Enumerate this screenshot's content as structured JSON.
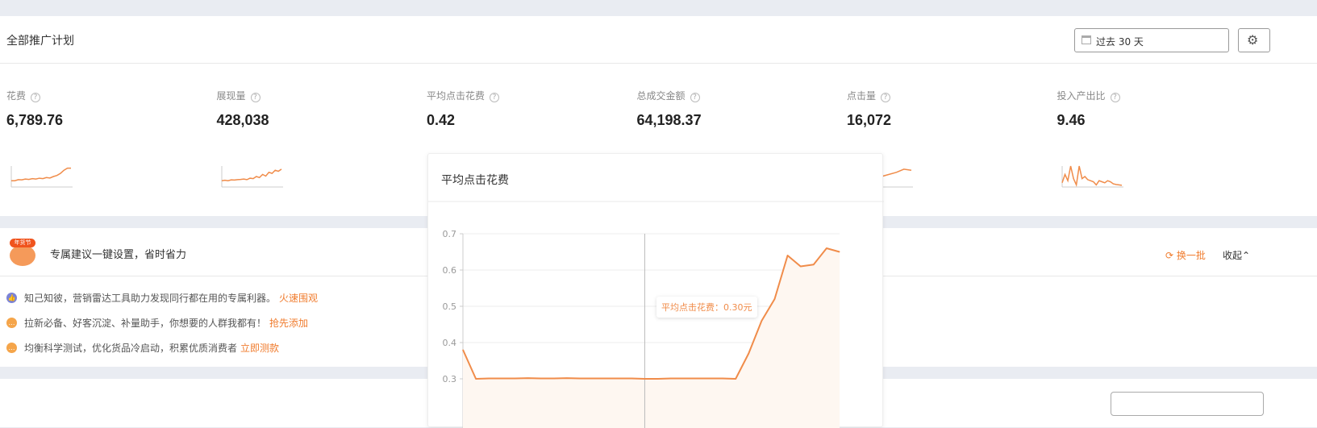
{
  "header": {
    "title": "全部推广计划",
    "date_range": "过去 30 天"
  },
  "metrics": [
    {
      "label": "花费",
      "value": "6,789.76",
      "trend": [
        3,
        3,
        3.5,
        3.4,
        3.8,
        3.6,
        4,
        3.8,
        4.2,
        4,
        4.5,
        4.3,
        5,
        5.5,
        6.5,
        8,
        9,
        9
      ]
    },
    {
      "label": "展现量",
      "value": "428,038",
      "trend": [
        3,
        3.2,
        3,
        3.4,
        3.3,
        3.5,
        3.6,
        3.8,
        3.5,
        4.2,
        4,
        5,
        4.5,
        6,
        5.2,
        7,
        6.5,
        8,
        7.5,
        8.5
      ]
    },
    {
      "label": "平均点击花费",
      "value": "0.42",
      "trend": []
    },
    {
      "label": "总成交金额",
      "value": "64,198.37",
      "trend": []
    },
    {
      "label": "点击量",
      "value": "16,072",
      "trend": [
        3,
        3.5,
        4,
        4.5,
        5,
        6,
        7,
        8.5,
        8
      ]
    },
    {
      "label": "投入产出比",
      "value": "9.46",
      "trend": [
        2,
        6,
        3,
        10,
        4,
        1,
        10,
        4,
        5,
        3.5,
        3,
        2.5,
        1,
        3,
        2.5,
        2,
        3,
        2.5,
        1.5,
        1.2,
        1,
        0.8
      ]
    }
  ],
  "suggestion": {
    "badge": "年货节",
    "title": "专属建议一键设置，省时省力",
    "refresh": "换一批",
    "collapse": "收起",
    "items": [
      {
        "text": "知己知彼，营销雷达工具助力发现同行都在用的专属利器。",
        "link": "火速围观",
        "color": "#7b83d6"
      },
      {
        "text": "拉新必备、好客沉淀、补量助手，你想要的人群我都有！",
        "link": "抢先添加",
        "color": "#f5a54a"
      },
      {
        "text": "均衡科学测试，优化货品冷启动，积累优质消费者",
        "link": "立即测款",
        "color": "#f5a54a"
      }
    ]
  },
  "popup": {
    "title": "平均点击花费",
    "tooltip": "平均点击花费：0.30元"
  },
  "chart_data": {
    "type": "area",
    "title": "平均点击花费",
    "yticks": [
      "0.7",
      "0.6",
      "0.5",
      "0.4",
      "0.3"
    ],
    "ylim": [
      0.2,
      0.7
    ],
    "values": [
      0.38,
      0.3,
      0.301,
      0.301,
      0.301,
      0.302,
      0.301,
      0.301,
      0.302,
      0.301,
      0.301,
      0.301,
      0.301,
      0.301,
      0.3,
      0.3,
      0.301,
      0.301,
      0.301,
      0.301,
      0.301,
      0.3,
      0.37,
      0.46,
      0.52,
      0.64,
      0.61,
      0.615,
      0.66,
      0.65
    ],
    "highlight_index": 14,
    "color": "#f08c4a"
  }
}
